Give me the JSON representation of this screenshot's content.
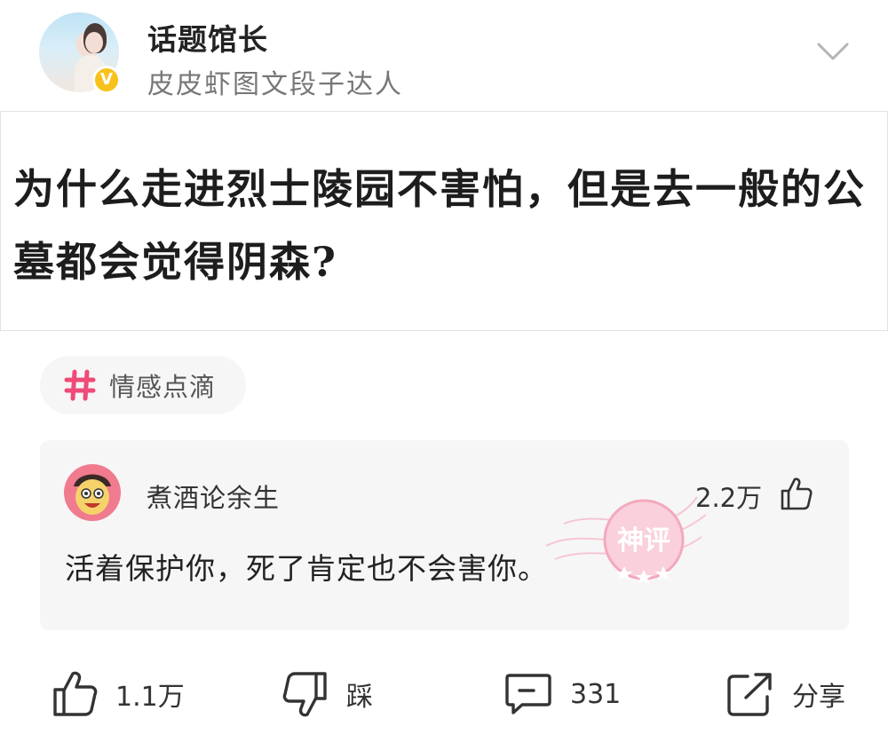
{
  "author": {
    "name": "话题馆长",
    "subtitle": "皮皮虾图文段子达人",
    "verified_color": "#f7c21c"
  },
  "question": {
    "text": "为什么走进烈士陵园不害怕，但是去一般的公墓都会觉得阴森?"
  },
  "topic": {
    "icon": "hash-icon",
    "label": "情感点滴",
    "accent": "#f04a78"
  },
  "comment": {
    "username": "煮酒论余生",
    "like_count": "2.2万",
    "text": "活着保护你，死了肯定也不会害你。",
    "stamp_text": "神评"
  },
  "actions": {
    "like": "1.1万",
    "dislike": "踩",
    "comment": "331",
    "share": "分享"
  }
}
